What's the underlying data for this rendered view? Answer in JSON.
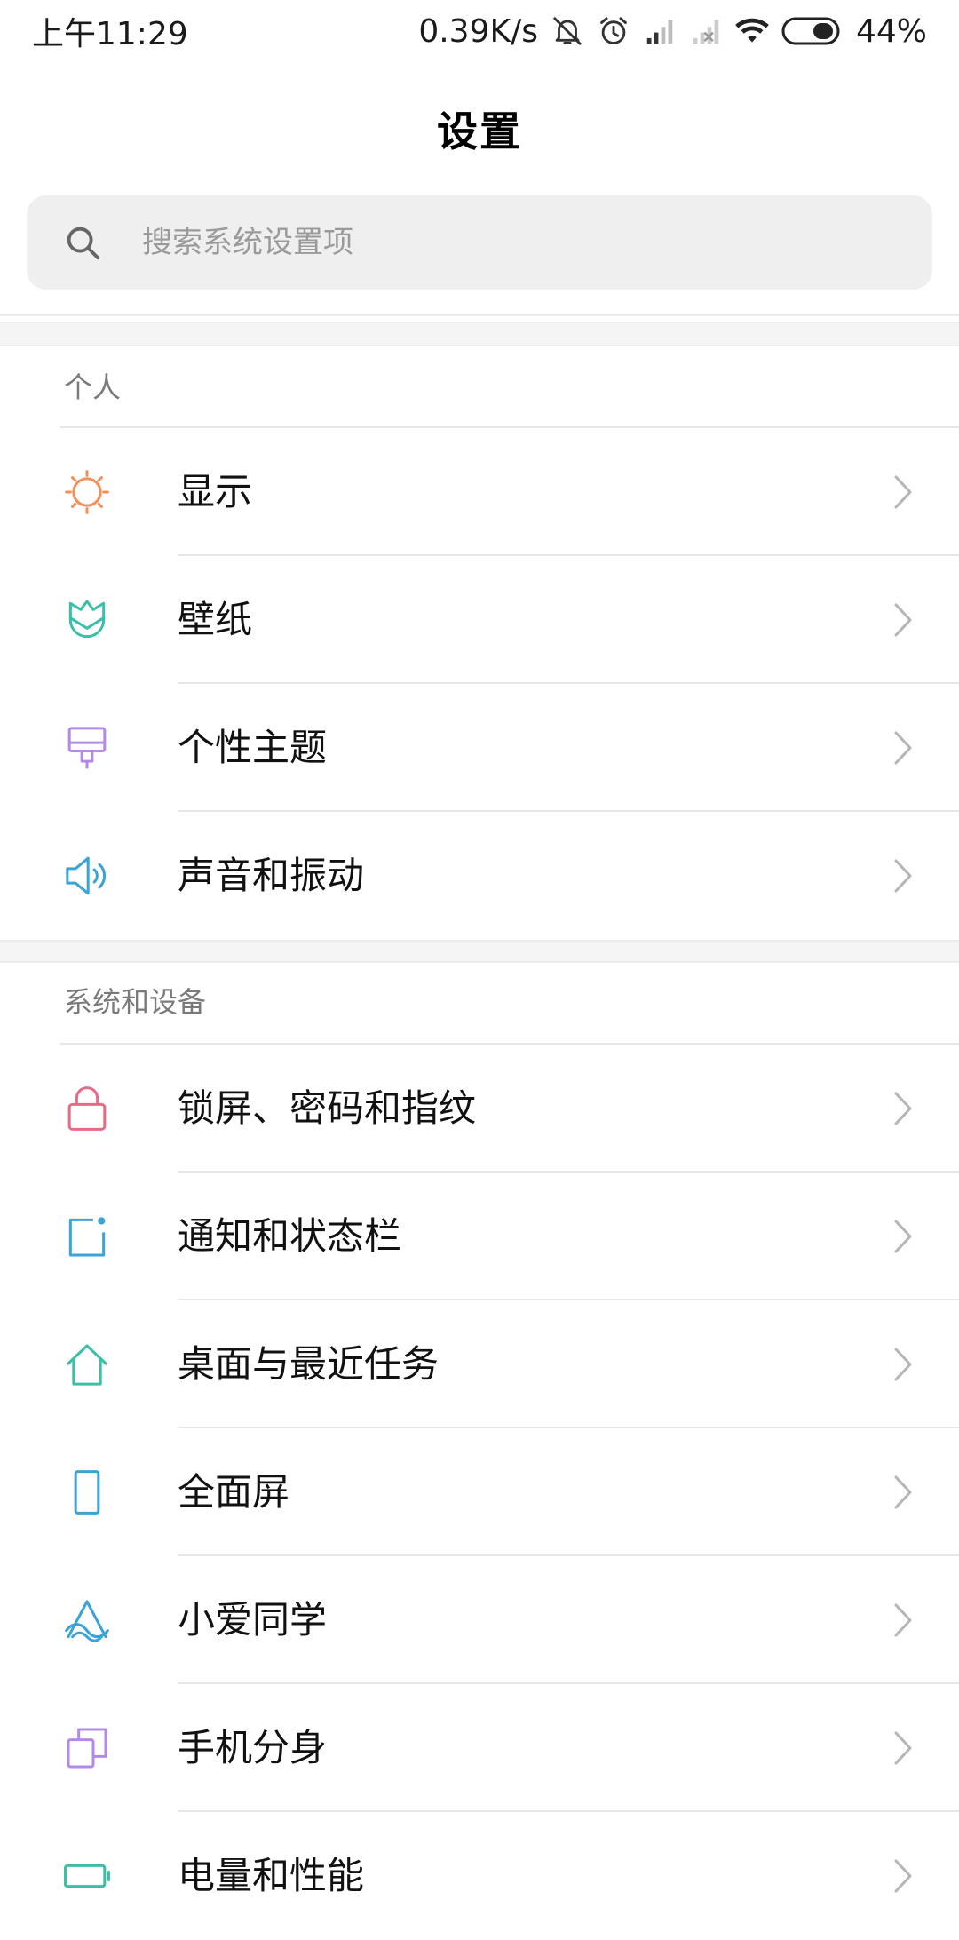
{
  "status_bar": {
    "time": "上午11:29",
    "network_speed": "0.39K/s",
    "battery": "44%",
    "icons": [
      "mute-bell-icon",
      "alarm-icon",
      "signal-icon",
      "signal-no-sim-icon",
      "wifi-icon",
      "battery-icon"
    ]
  },
  "header": {
    "title": "设置"
  },
  "search": {
    "placeholder": "搜索系统设置项",
    "icon": "search-icon"
  },
  "sections": [
    {
      "title": "个人",
      "items": [
        {
          "label": "显示",
          "icon": "sun-icon",
          "color": "#f0905a"
        },
        {
          "label": "壁纸",
          "icon": "tulip-icon",
          "color": "#3cbfa8"
        },
        {
          "label": "个性主题",
          "icon": "paint-brush-icon",
          "color": "#b38be6"
        },
        {
          "label": "声音和振动",
          "icon": "speaker-icon",
          "color": "#3aa3d8"
        }
      ]
    },
    {
      "title": "系统和设备",
      "items": [
        {
          "label": "锁屏、密码和指纹",
          "icon": "lock-icon",
          "color": "#e86a86"
        },
        {
          "label": "通知和状态栏",
          "icon": "notification-icon",
          "color": "#3aa3d8"
        },
        {
          "label": "桌面与最近任务",
          "icon": "home-icon",
          "color": "#3cbfa8"
        },
        {
          "label": "全面屏",
          "icon": "phone-icon",
          "color": "#3aa3d8"
        },
        {
          "label": "小爱同学",
          "icon": "xiaoai-icon",
          "color": "#3aa3d8"
        },
        {
          "label": "手机分身",
          "icon": "dual-space-icon",
          "color": "#b38be6"
        },
        {
          "label": "电量和性能",
          "icon": "battery-outline-icon",
          "color": "#3cbfa8"
        }
      ]
    }
  ],
  "chevron_color": "#b5b5b5"
}
